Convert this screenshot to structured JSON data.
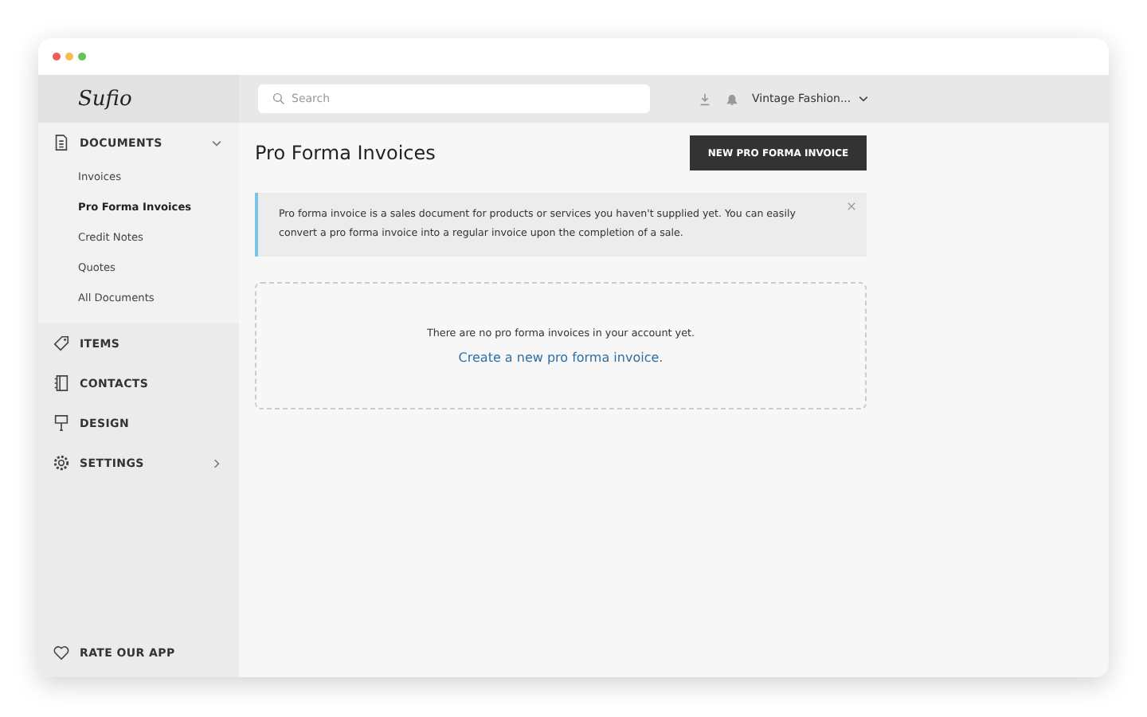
{
  "brand": {
    "logo": "Sufio"
  },
  "search": {
    "placeholder": "Search"
  },
  "account": {
    "name": "Vintage Fashion..."
  },
  "sidebar": {
    "items": [
      {
        "label": "DOCUMENTS",
        "expanded": true,
        "children": [
          {
            "label": "Invoices",
            "selected": false
          },
          {
            "label": "Pro Forma Invoices",
            "selected": true
          },
          {
            "label": "Credit Notes",
            "selected": false
          },
          {
            "label": "Quotes",
            "selected": false
          },
          {
            "label": "All Documents",
            "selected": false
          }
        ]
      },
      {
        "label": "ITEMS"
      },
      {
        "label": "CONTACTS"
      },
      {
        "label": "DESIGN"
      },
      {
        "label": "SETTINGS",
        "expanded": false
      }
    ],
    "footer": {
      "label": "RATE OUR APP"
    }
  },
  "page": {
    "title": "Pro Forma Invoices",
    "button": "NEW PRO FORMA INVOICE",
    "notice": "Pro forma invoice is a sales document for products or services you haven't supplied yet. You can easily convert a pro forma invoice into a regular invoice upon the completion of a sale.",
    "empty": {
      "message": "There are no pro forma invoices in your account yet.",
      "link": "Create a new pro forma invoice."
    }
  }
}
